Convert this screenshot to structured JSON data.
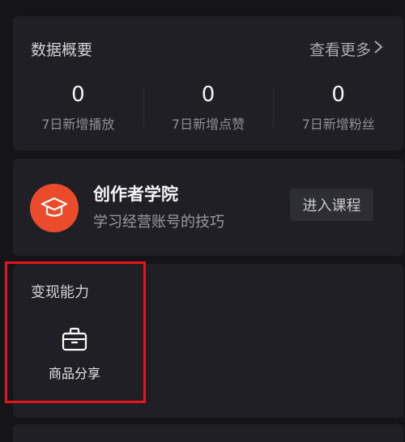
{
  "overview": {
    "title": "数据概要",
    "more": "查看更多",
    "stats": [
      {
        "value": "0",
        "label": "7日新增播放"
      },
      {
        "value": "0",
        "label": "7日新增点赞"
      },
      {
        "value": "0",
        "label": "7日新增粉丝"
      }
    ]
  },
  "academy": {
    "icon": "graduation-cap-icon",
    "title": "创作者学院",
    "subtitle": "学习经营账号的技巧",
    "button": "进入课程"
  },
  "monetize": {
    "title": "变现能力",
    "items": [
      {
        "icon": "shopping-bag-icon",
        "label": "商品分享"
      }
    ]
  },
  "colors": {
    "background": "#151519",
    "card": "#1f1f25",
    "accent": "#ea4b2b",
    "highlight": "#e6141c"
  }
}
